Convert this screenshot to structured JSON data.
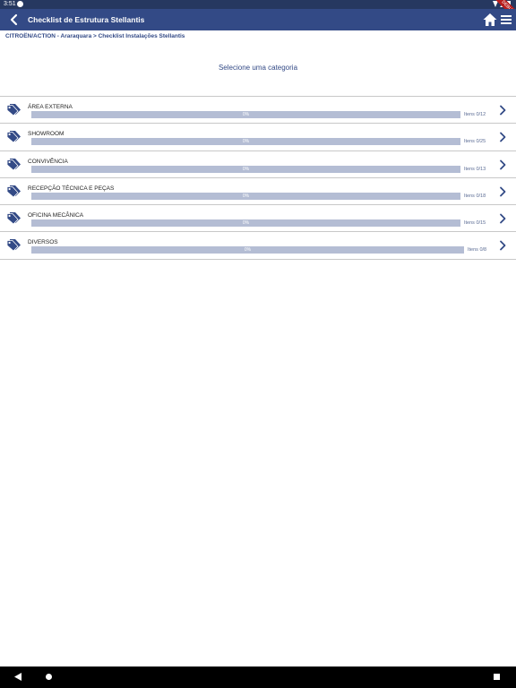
{
  "status_bar": {
    "time": "3:51",
    "debug_label": "DEBUG"
  },
  "app_bar": {
    "title": "Checklist de Estrutura Stellantis"
  },
  "breadcrumb": "CITROËN/ACTION - Araraquara > Checklist Instalações Stellantis",
  "subtitle": "Selecione uma categoria",
  "icons": {
    "category": "tag-icon",
    "row_action": "chevron-right-icon",
    "home": "home-icon",
    "menu": "menu-icon",
    "back": "arrow-back-icon"
  },
  "colors": {
    "primary": "#334a86",
    "status_bar": "#263860",
    "progress_track": "#b4bdd4",
    "divider": "#c8c8c8"
  },
  "categories": [
    {
      "name": "ÁREA EXTERNA",
      "progress": 0,
      "progress_label": "0%",
      "items_label": "Itens 0/12"
    },
    {
      "name": "SHOWROOM",
      "progress": 0,
      "progress_label": "0%",
      "items_label": "Itens 0/25"
    },
    {
      "name": "CONVIVÊNCIA",
      "progress": 0,
      "progress_label": "0%",
      "items_label": "Itens 0/13"
    },
    {
      "name": "RECEPÇÃO TÉCNICA E PEÇAS",
      "progress": 0,
      "progress_label": "0%",
      "items_label": "Itens 0/18"
    },
    {
      "name": "OFICINA MECÂNICA",
      "progress": 0,
      "progress_label": "0%",
      "items_label": "Itens 0/15"
    },
    {
      "name": "DIVERSOS",
      "progress": 0,
      "progress_label": "0%",
      "items_label": "Itens 0/8"
    }
  ]
}
